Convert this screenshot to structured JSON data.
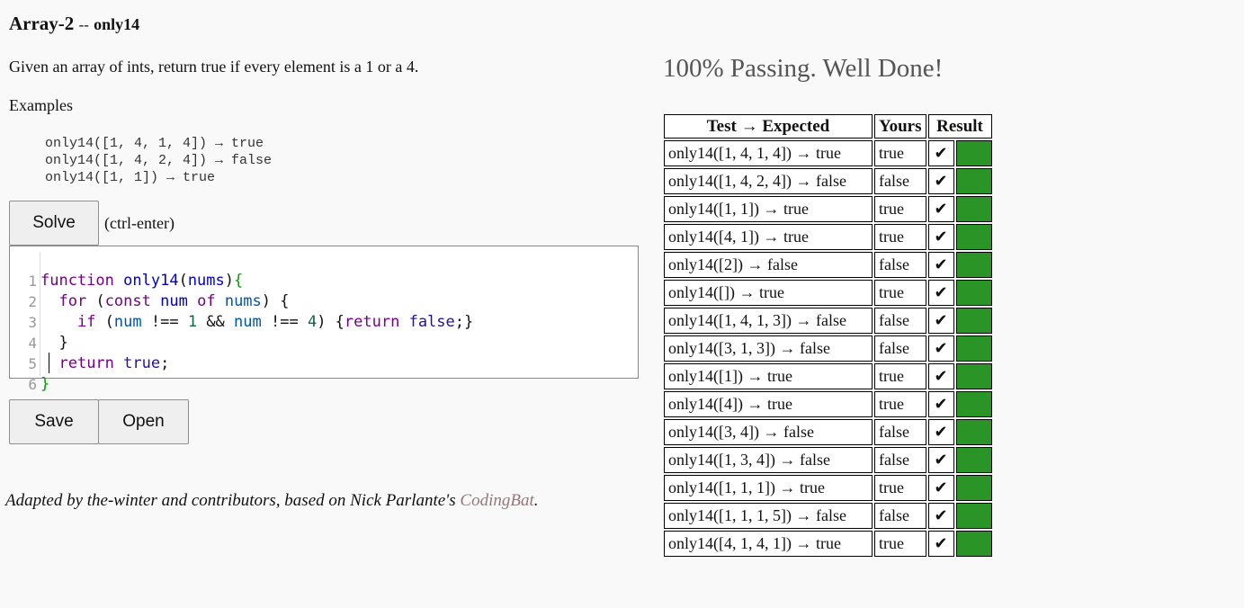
{
  "header": {
    "category": "Array-2",
    "separator": "--",
    "problem": "only14"
  },
  "description": "Given an array of ints, return true if every element is a 1 or a 4.",
  "examples_label": "Examples",
  "examples": [
    "only14([1, 4, 1, 4]) → true",
    "only14([1, 4, 2, 4]) → false",
    "only14([1, 1]) → true"
  ],
  "solve_button": "Solve",
  "solve_hint": "(ctrl-enter)",
  "editor": {
    "line_numbers": [
      "1",
      "2",
      "3",
      "4",
      "5",
      "6"
    ]
  },
  "save_button": "Save",
  "open_button": "Open",
  "footer": {
    "text": "Adapted by the-winter and contributors, based on Nick Parlante's ",
    "link": "CodingBat",
    "end": "."
  },
  "status": "100% Passing. Well Done!",
  "results": {
    "headers": [
      "Test → Expected",
      "Yours",
      "Result"
    ],
    "pass_color": "#2b9427",
    "check_icon": "✔",
    "rows": [
      {
        "test": "only14([1, 4, 1, 4]) → true",
        "yours": "true"
      },
      {
        "test": "only14([1, 4, 2, 4]) → false",
        "yours": "false"
      },
      {
        "test": "only14([1, 1]) → true",
        "yours": "true"
      },
      {
        "test": "only14([4, 1]) → true",
        "yours": "true"
      },
      {
        "test": "only14([2]) → false",
        "yours": "false"
      },
      {
        "test": "only14([]) → true",
        "yours": "true"
      },
      {
        "test": "only14([1, 4, 1, 3]) → false",
        "yours": "false"
      },
      {
        "test": "only14([3, 1, 3]) → false",
        "yours": "false"
      },
      {
        "test": "only14([1]) → true",
        "yours": "true"
      },
      {
        "test": "only14([4]) → true",
        "yours": "true"
      },
      {
        "test": "only14([3, 4]) → false",
        "yours": "false"
      },
      {
        "test": "only14([1, 3, 4]) → false",
        "yours": "false"
      },
      {
        "test": "only14([1, 1, 1]) → true",
        "yours": "true"
      },
      {
        "test": "only14([1, 1, 1, 5]) → false",
        "yours": "false"
      },
      {
        "test": "only14([4, 1, 4, 1]) → true",
        "yours": "true"
      }
    ]
  }
}
